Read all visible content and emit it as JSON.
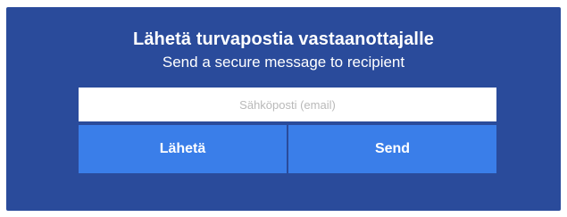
{
  "form": {
    "title": "Lähetä turvapostia vastaanottajalle",
    "subtitle": "Send a secure message to recipient",
    "email_placeholder": "Sähköposti (email)",
    "email_value": "",
    "send_fi_label": "Lähetä",
    "send_en_label": "Send"
  },
  "colors": {
    "panel_background": "#2a4b9b",
    "button_background": "#3a7ee9",
    "text": "#ffffff"
  }
}
